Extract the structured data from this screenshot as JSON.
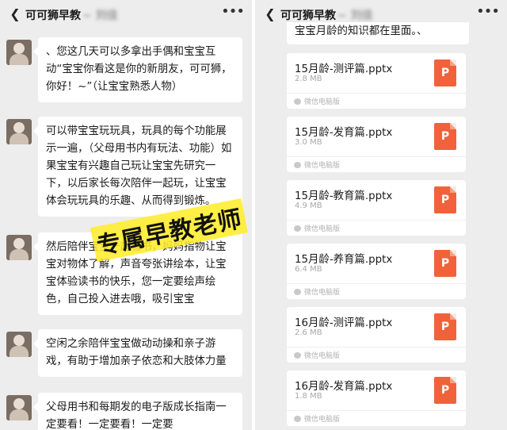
{
  "left_chat": {
    "title": "可可狮早教",
    "title_suffix": "~ 刘佳",
    "messages": [
      {
        "text": "、您这几天可以多拿出手偶和宝宝互动“宝宝你看这是你的新朋友，可可狮，你好！~”（让宝宝熟悉人物）"
      },
      {
        "text": "可以带宝宝玩玩具，玩具的每个功能展示一遍，（父母用书内有玩法、功能）如果宝宝有兴趣自己玩让宝宝先研究一下，以后家长每次陪伴一起玩，让宝宝体会玩玩具的乐趣、从而得到锻炼。"
      },
      {
        "text": "然后陪伴宝宝一起看书，妈妈指物让宝宝对物体了解，声音夸张讲绘本，让宝宝体验读书的快乐，您一定要绘声绘色，自己投入进去哦，吸引宝宝"
      },
      {
        "text": "空闲之余陪伴宝宝做动动操和亲子游戏，有助于增加亲子依恋和大肢体力量"
      },
      {
        "text": "父母用书和每期发的电子版成长指南一定要看！一定要看！一定要"
      }
    ],
    "watermark": "专属早教老师"
  },
  "right_chat": {
    "title": "可可狮早教",
    "title_suffix": "~ 刘佳",
    "top_message": "宝宝月龄的知识都在里面。、",
    "files": [
      {
        "name": "15月龄-测评篇.pptx",
        "size": "2.8 MB",
        "source": "微信电脑版",
        "icon_letter": "P"
      },
      {
        "name": "15月龄-发育篇.pptx",
        "size": "3.0 MB",
        "source": "微信电脑版",
        "icon_letter": "P"
      },
      {
        "name": "15月龄-教育篇.pptx",
        "size": "4.9 MB",
        "source": "微信电脑版",
        "icon_letter": "P"
      },
      {
        "name": "15月龄-养育篇.pptx",
        "size": "6.4 MB",
        "source": "微信电脑版",
        "icon_letter": "P"
      },
      {
        "name": "16月龄-测评篇.pptx",
        "size": "2.6 MB",
        "source": "微信电脑版",
        "icon_letter": "P"
      },
      {
        "name": "16月龄-发育篇.pptx",
        "size": "1.8 MB",
        "source": "微信电脑版",
        "icon_letter": "P"
      }
    ]
  },
  "icons": {
    "back": "chevron-left-icon",
    "more": "more-icon",
    "file": "ppt-file-icon",
    "source": "wechat-icon"
  },
  "colors": {
    "chat_background": "#ededed",
    "bubble": "#ffffff",
    "ppt_icon": "#f1623a",
    "watermark_highlight": "#ffec28"
  }
}
